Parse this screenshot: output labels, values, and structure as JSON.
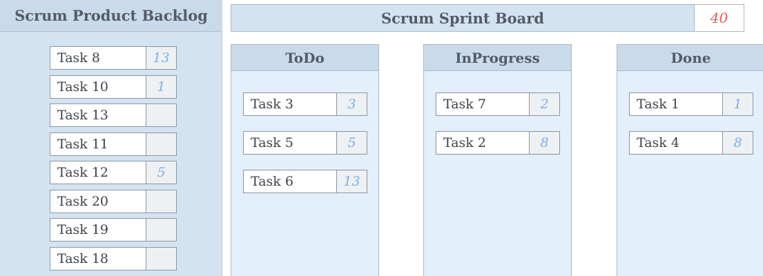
{
  "backlog": {
    "title": "Scrum Product Backlog",
    "tasks": [
      {
        "name": "Task 8",
        "points": "13"
      },
      {
        "name": "Task 10",
        "points": "1"
      },
      {
        "name": "Task 13",
        "points": ""
      },
      {
        "name": "Task 11",
        "points": ""
      },
      {
        "name": "Task 12",
        "points": "5"
      },
      {
        "name": "Task 20",
        "points": ""
      },
      {
        "name": "Task 19",
        "points": ""
      },
      {
        "name": "Task 18",
        "points": ""
      }
    ]
  },
  "sprint": {
    "title": "Scrum Sprint Board",
    "total_points": "40",
    "columns": [
      {
        "title": "ToDo",
        "tasks": [
          {
            "name": "Task 3",
            "points": "3"
          },
          {
            "name": "Task 5",
            "points": "5"
          },
          {
            "name": "Task 6",
            "points": "13"
          }
        ]
      },
      {
        "title": "InProgress",
        "tasks": [
          {
            "name": "Task 7",
            "points": "2"
          },
          {
            "name": "Task 2",
            "points": "8"
          }
        ]
      },
      {
        "title": "Done",
        "tasks": [
          {
            "name": "Task 1",
            "points": "1"
          },
          {
            "name": "Task 4",
            "points": "8"
          }
        ]
      }
    ]
  },
  "colors": {
    "panel": "#d4e3f2",
    "header": "#c9dbeb",
    "column_body": "#e3effb",
    "points_text": "#7aaee3",
    "total_text": "#e0605e"
  }
}
